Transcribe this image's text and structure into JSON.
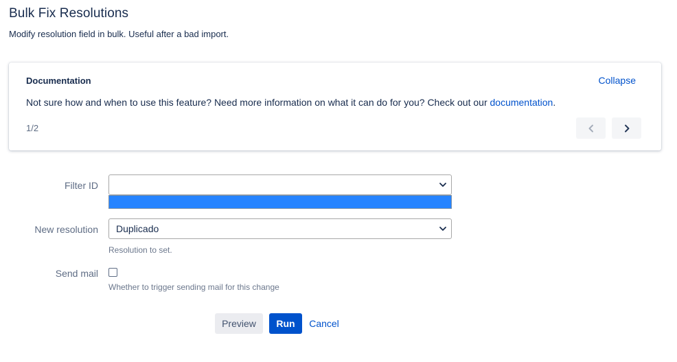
{
  "header": {
    "title": "Bulk Fix Resolutions",
    "subtitle": "Modify resolution field in bulk. Useful after a bad import."
  },
  "documentation": {
    "title": "Documentation",
    "collapse_label": "Collapse",
    "text_before_link": "Not sure how and when to use this feature? Need more information on what it can do for you? Check out our ",
    "link_label": "documentation",
    "text_after_link": ".",
    "page_indicator": "1/2",
    "prev_icon": "chevron-left-icon",
    "next_icon": "chevron-right-icon"
  },
  "form": {
    "filter_id": {
      "label": "Filter ID",
      "value": "",
      "dropdown_open": true
    },
    "new_resolution": {
      "label": "New resolution",
      "value": "Duplicado",
      "help": "Resolution to set."
    },
    "send_mail": {
      "label": "Send mail",
      "checked": false,
      "help": "Whether to trigger sending mail for this change"
    }
  },
  "actions": {
    "preview_label": "Preview",
    "run_label": "Run",
    "cancel_label": "Cancel"
  },
  "colors": {
    "primary": "#0052cc",
    "dropdown_highlight": "#2684ff",
    "text": "#172b4d",
    "muted": "#5e6c84"
  }
}
